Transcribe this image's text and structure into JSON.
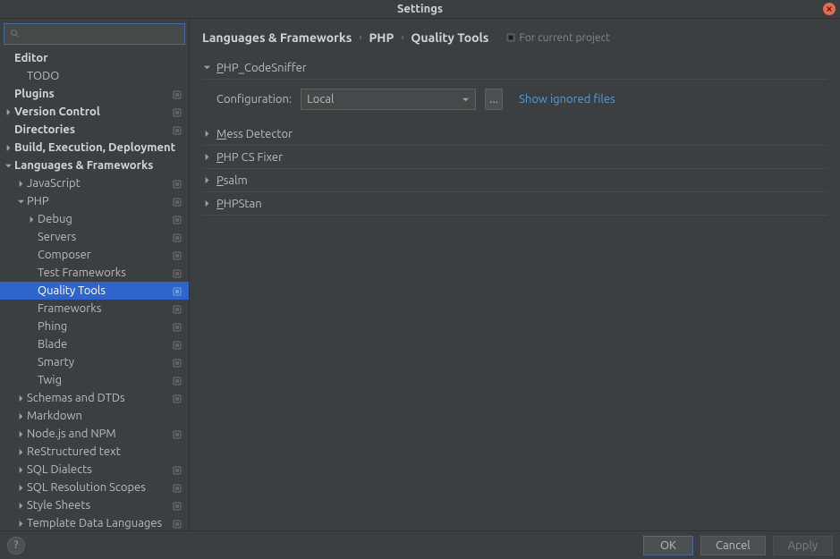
{
  "window": {
    "title": "Settings"
  },
  "search": {
    "placeholder": ""
  },
  "tree": [
    {
      "label": "Editor",
      "indent": 0,
      "bold": true,
      "arrow": null,
      "marker": false
    },
    {
      "label": "TODO",
      "indent": 1,
      "bold": false,
      "arrow": null,
      "marker": false
    },
    {
      "label": "Plugins",
      "indent": 0,
      "bold": true,
      "arrow": null,
      "marker": true
    },
    {
      "label": "Version Control",
      "indent": 0,
      "bold": true,
      "arrow": "right",
      "marker": true
    },
    {
      "label": "Directories",
      "indent": 0,
      "bold": true,
      "arrow": null,
      "marker": true
    },
    {
      "label": "Build, Execution, Deployment",
      "indent": 0,
      "bold": true,
      "arrow": "right",
      "marker": false
    },
    {
      "label": "Languages & Frameworks",
      "indent": 0,
      "bold": true,
      "arrow": "down",
      "marker": false
    },
    {
      "label": "JavaScript",
      "indent": 1,
      "bold": false,
      "arrow": "right",
      "marker": true
    },
    {
      "label": "PHP",
      "indent": 1,
      "bold": false,
      "arrow": "down",
      "marker": true
    },
    {
      "label": "Debug",
      "indent": 2,
      "bold": false,
      "arrow": "right",
      "marker": true
    },
    {
      "label": "Servers",
      "indent": 2,
      "bold": false,
      "arrow": null,
      "marker": true
    },
    {
      "label": "Composer",
      "indent": 2,
      "bold": false,
      "arrow": null,
      "marker": true
    },
    {
      "label": "Test Frameworks",
      "indent": 2,
      "bold": false,
      "arrow": null,
      "marker": true
    },
    {
      "label": "Quality Tools",
      "indent": 2,
      "bold": false,
      "arrow": null,
      "marker": true,
      "selected": true
    },
    {
      "label": "Frameworks",
      "indent": 2,
      "bold": false,
      "arrow": null,
      "marker": true
    },
    {
      "label": "Phing",
      "indent": 2,
      "bold": false,
      "arrow": null,
      "marker": true
    },
    {
      "label": "Blade",
      "indent": 2,
      "bold": false,
      "arrow": null,
      "marker": true
    },
    {
      "label": "Smarty",
      "indent": 2,
      "bold": false,
      "arrow": null,
      "marker": true
    },
    {
      "label": "Twig",
      "indent": 2,
      "bold": false,
      "arrow": null,
      "marker": true
    },
    {
      "label": "Schemas and DTDs",
      "indent": 1,
      "bold": false,
      "arrow": "right",
      "marker": true
    },
    {
      "label": "Markdown",
      "indent": 1,
      "bold": false,
      "arrow": "right",
      "marker": false
    },
    {
      "label": "Node.js and NPM",
      "indent": 1,
      "bold": false,
      "arrow": "right",
      "marker": true
    },
    {
      "label": "ReStructured text",
      "indent": 1,
      "bold": false,
      "arrow": "right",
      "marker": false
    },
    {
      "label": "SQL Dialects",
      "indent": 1,
      "bold": false,
      "arrow": "right",
      "marker": true
    },
    {
      "label": "SQL Resolution Scopes",
      "indent": 1,
      "bold": false,
      "arrow": "right",
      "marker": true
    },
    {
      "label": "Style Sheets",
      "indent": 1,
      "bold": false,
      "arrow": "right",
      "marker": true
    },
    {
      "label": "Template Data Languages",
      "indent": 1,
      "bold": false,
      "arrow": "right",
      "marker": true
    }
  ],
  "breadcrumb": {
    "items": [
      "Languages & Frameworks",
      "PHP",
      "Quality Tools"
    ],
    "hint": "For current project"
  },
  "sections": [
    {
      "title": "PHP_CodeSniffer",
      "expanded": true
    },
    {
      "title": "Mess Detector",
      "expanded": false
    },
    {
      "title": "PHP CS Fixer",
      "expanded": false
    },
    {
      "title": "Psalm",
      "expanded": false
    },
    {
      "title": "PHPStan",
      "expanded": false
    }
  ],
  "config": {
    "label": "Configuration:",
    "value": "Local",
    "browse": "...",
    "link": "Show ignored files"
  },
  "footer": {
    "help": "?",
    "ok": "OK",
    "cancel": "Cancel",
    "apply": "Apply"
  }
}
